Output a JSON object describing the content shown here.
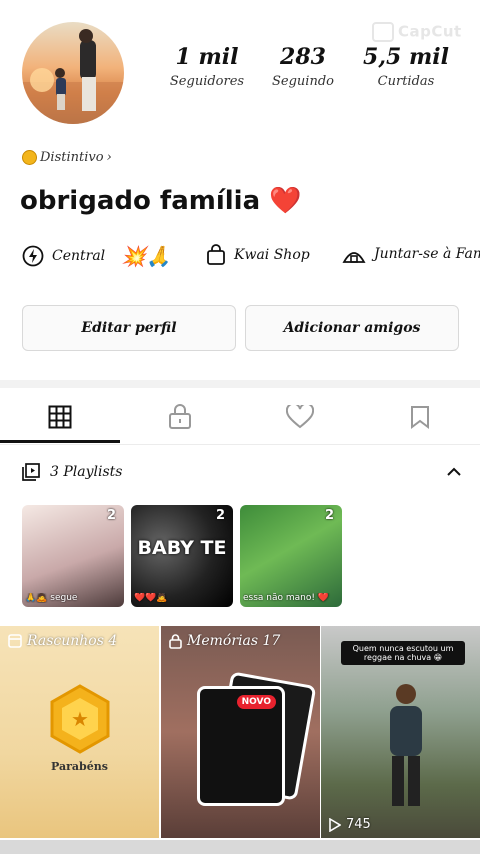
{
  "watermark": "CapCut",
  "profile": {
    "stats": [
      {
        "value": "1 mil",
        "label": "Seguidores"
      },
      {
        "value": "283",
        "label": "Seguindo"
      },
      {
        "value": "5,5 mil",
        "label": "Curtidas"
      }
    ],
    "badge_label": "Distintivo",
    "bio": "obrigado família ❤️",
    "links": [
      {
        "label": "Central",
        "icon": "lightning-icon",
        "emoji": "💥🙏"
      },
      {
        "label": "Kwai Shop",
        "icon": "shopping-bag-icon"
      },
      {
        "label": "Juntar-se à Fam",
        "icon": "family-house-icon"
      }
    ],
    "buttons": {
      "edit": "Editar perfil",
      "add_friends": "Adicionar amigos"
    }
  },
  "tabs": [
    {
      "name": "grid",
      "icon": "grid-icon",
      "active": true
    },
    {
      "name": "private",
      "icon": "lock-icon"
    },
    {
      "name": "liked",
      "icon": "heart-icon"
    },
    {
      "name": "saved",
      "icon": "bookmark-icon"
    }
  ],
  "playlists": {
    "header": "3 Playlists",
    "items": [
      {
        "count": "2",
        "caption": "🙏🙇 segue",
        "overlay_text": ""
      },
      {
        "count": "2",
        "caption": "❤️❤️🙇",
        "overlay_text": "BABY TE"
      },
      {
        "count": "2",
        "caption": "essa não mano! ❤️",
        "overlay_text": ""
      }
    ]
  },
  "grid": {
    "drafts_label": "Rascunhos 4",
    "memories_label": "Memórias 17",
    "drafts_inner_text": "Parabéns",
    "memories_card_text": "NOVO",
    "video_top_text": "Quem nunca escutou um reggae na chuva 😁",
    "video_views": "745"
  },
  "colors": {
    "accent_red": "#e8222e",
    "badge_gold": "#f3b51b",
    "drafts_bg": "#f1d7a0"
  }
}
